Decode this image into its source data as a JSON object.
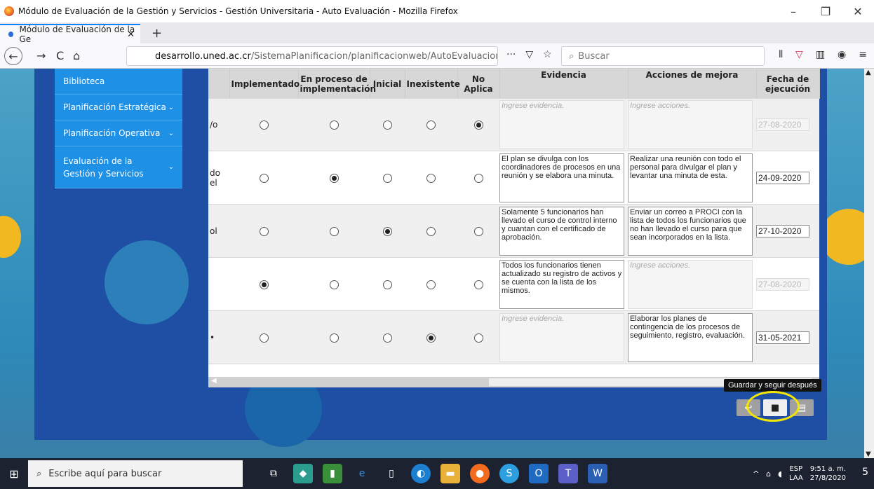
{
  "window": {
    "title": "Módulo de Evaluación de la Gestión y Servicios - Gestión Universitaria - Auto Evaluación - Mozilla Firefox",
    "minimize": "–",
    "restore": "❐",
    "close": "✕"
  },
  "tab": {
    "label": "Módulo de Evaluación de la Ge",
    "close": "✕",
    "new": "+"
  },
  "nav": {
    "back": "←",
    "forward": "→",
    "reload": "C",
    "home": "⌂",
    "url_domain": "desarrollo.uned.ac.cr",
    "url_path": "/SistemaPlanificacion/planificacionweb/AutoEvaluacionGU?i",
    "more": "···",
    "search_placeholder": "Buscar"
  },
  "sidebar": {
    "items": [
      {
        "label": "Biblioteca",
        "chev": ""
      },
      {
        "label": "Planificación Estratégica",
        "chev": "⌄"
      },
      {
        "label": "Planificación Operativa",
        "chev": "⌄"
      },
      {
        "label": "Evaluación de la Gestión y Servicios",
        "chev": "⌄"
      }
    ]
  },
  "table": {
    "headers": [
      "",
      "Implementado",
      "En proceso de implementación",
      "Inicial",
      "Inexistente",
      "No Aplica",
      "Evidencia",
      "Acciones de mejora",
      "Fecha de ejecución"
    ],
    "rows": [
      {
        "frag": "/o",
        "selected": 4,
        "evidencia": "",
        "acciones": "",
        "fecha": "27-08-2020",
        "fecha_disabled": true
      },
      {
        "frag": "do el",
        "selected": 1,
        "evidencia": "El plan se divulga con los coordinadores de procesos en una reunión y se elabora una minuta.",
        "acciones": "Realizar una reunión con todo el personal para divulgar el plan y levantar una minuta de esta.",
        "fecha": "24-09-2020",
        "fecha_disabled": false
      },
      {
        "frag": "ol",
        "selected": 2,
        "evidencia": "Solamente 5 funcionarios han llevado el curso de control interno y cuantan con el certificado de aprobación.",
        "acciones": "Enviar un correo a PROCI con la lista de todos los funcionarios que no han llevado el curso para que sean incorporados en la lista.",
        "fecha": "27-10-2020",
        "fecha_disabled": false
      },
      {
        "frag": "",
        "selected": 0,
        "evidencia": "Todos los funcionarios tienen actualizado su registro de activos y se cuenta con la lista de los mismos.",
        "acciones": "",
        "fecha": "27-08-2020",
        "fecha_disabled": true
      },
      {
        "frag": "•",
        "selected": 3,
        "evidencia": "",
        "acciones": "Elaborar los planes de contingencia de los procesos de seguimiento, registro, evaluación.",
        "fecha": "31-05-2021",
        "fecha_disabled": false
      }
    ],
    "evidencia_placeholder": "Ingrese evidencia.",
    "acciones_placeholder": "Ingrese acciones."
  },
  "actions": {
    "back_icon": "↩",
    "save_icon": "💾",
    "doc_icon": "▤",
    "tooltip": "Guardar y seguir después"
  },
  "taskbar": {
    "search_placeholder": "Escribe aquí para buscar",
    "lang": "ESP",
    "lang2": "LAA",
    "time": "9:51 a. m.",
    "date": "27/8/2020",
    "notif": "5"
  },
  "colors": {
    "accent": "#0a84ff",
    "sidebar": "#1e90e6",
    "panel": "#1f4fa4",
    "highlight": "#f3e600"
  }
}
